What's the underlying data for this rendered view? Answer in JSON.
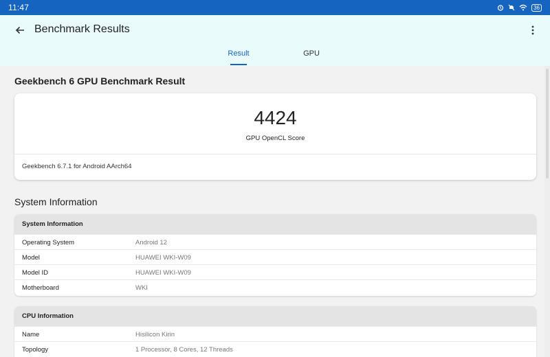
{
  "status_bar": {
    "time": "11:47",
    "battery": "36",
    "icons": [
      "alarm-icon",
      "mute-icon",
      "wifi-icon",
      "battery-icon"
    ]
  },
  "app_bar": {
    "title": "Benchmark Results",
    "icons": [
      "arrow-back-icon",
      "more-vertical-icon"
    ]
  },
  "tabs": [
    {
      "label": "Result",
      "selected": true
    },
    {
      "label": "GPU",
      "selected": false
    }
  ],
  "result": {
    "heading": "Geekbench 6 GPU Benchmark Result",
    "score": "4424",
    "score_label": "GPU OpenCL Score",
    "version_info": "Geekbench 6.7.1 for Android AArch64"
  },
  "system_info": {
    "section_title": "System Information",
    "table_title": "System Information",
    "rows": [
      {
        "key": "Operating System",
        "value": "Android 12"
      },
      {
        "key": "Model",
        "value": "HUAWEI WKI-W09"
      },
      {
        "key": "Model ID",
        "value": "HUAWEI WKI-W09"
      },
      {
        "key": "Motherboard",
        "value": "WKI"
      }
    ]
  },
  "cpu_info": {
    "table_title": "CPU Information",
    "rows": [
      {
        "key": "Name",
        "value": "Hisilicon Kirin"
      },
      {
        "key": "Topology",
        "value": "1 Processor, 8 Cores, 12 Threads"
      }
    ]
  },
  "colors": {
    "accent": "#1565c0",
    "app_bar_bg": "#e9fbfb",
    "table_header_bg": "#e4e4e4"
  }
}
